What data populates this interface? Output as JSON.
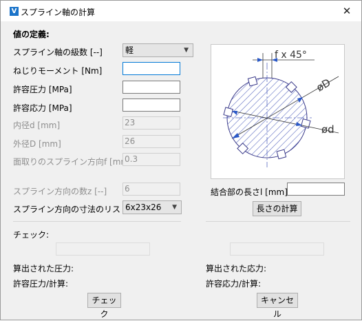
{
  "window": {
    "title": "スプライン軸の計算",
    "icon_letter": "V",
    "close_glyph": "✕"
  },
  "section_title": "値の定義:",
  "fields": {
    "grade_label": "スプライン軸の級数 [--]",
    "grade_value": "軽",
    "torque_label": "ねじりモーメント [Nm]",
    "allow_pressure_label": "許容圧力 [MPa]",
    "allow_stress_label": "許容応力 [MPa]",
    "inner_d_label": "内径d [mm]",
    "inner_d_value": "23",
    "outer_d_label": "外径D [mm]",
    "outer_d_value": "26",
    "chamfer_label": "面取りのスプライン方向f [mm]",
    "chamfer_value": "0.3",
    "teeth_label": "スプライン方向の数z [--]",
    "teeth_value": "6",
    "dims_list_label": "スプライン方向の寸法のリスト",
    "dims_list_value": "6x23x26"
  },
  "diagram": {
    "chamfer_annotation": "f x 45°",
    "outer_annotation": "øD",
    "inner_annotation": "ød"
  },
  "engagement_length_label": "結合部の長さl [mm]",
  "buttons": {
    "calc_length": "長さの計算",
    "check": "チェック",
    "cancel": "キャンセル"
  },
  "results": {
    "check_label": "チェック:",
    "computed_pressure_label": "算出された圧力:",
    "allow_pressure_calc_label": "許容圧力/計算:",
    "computed_stress_label": "算出された応力:",
    "allow_stress_calc_label": "許容応力/計算:"
  }
}
